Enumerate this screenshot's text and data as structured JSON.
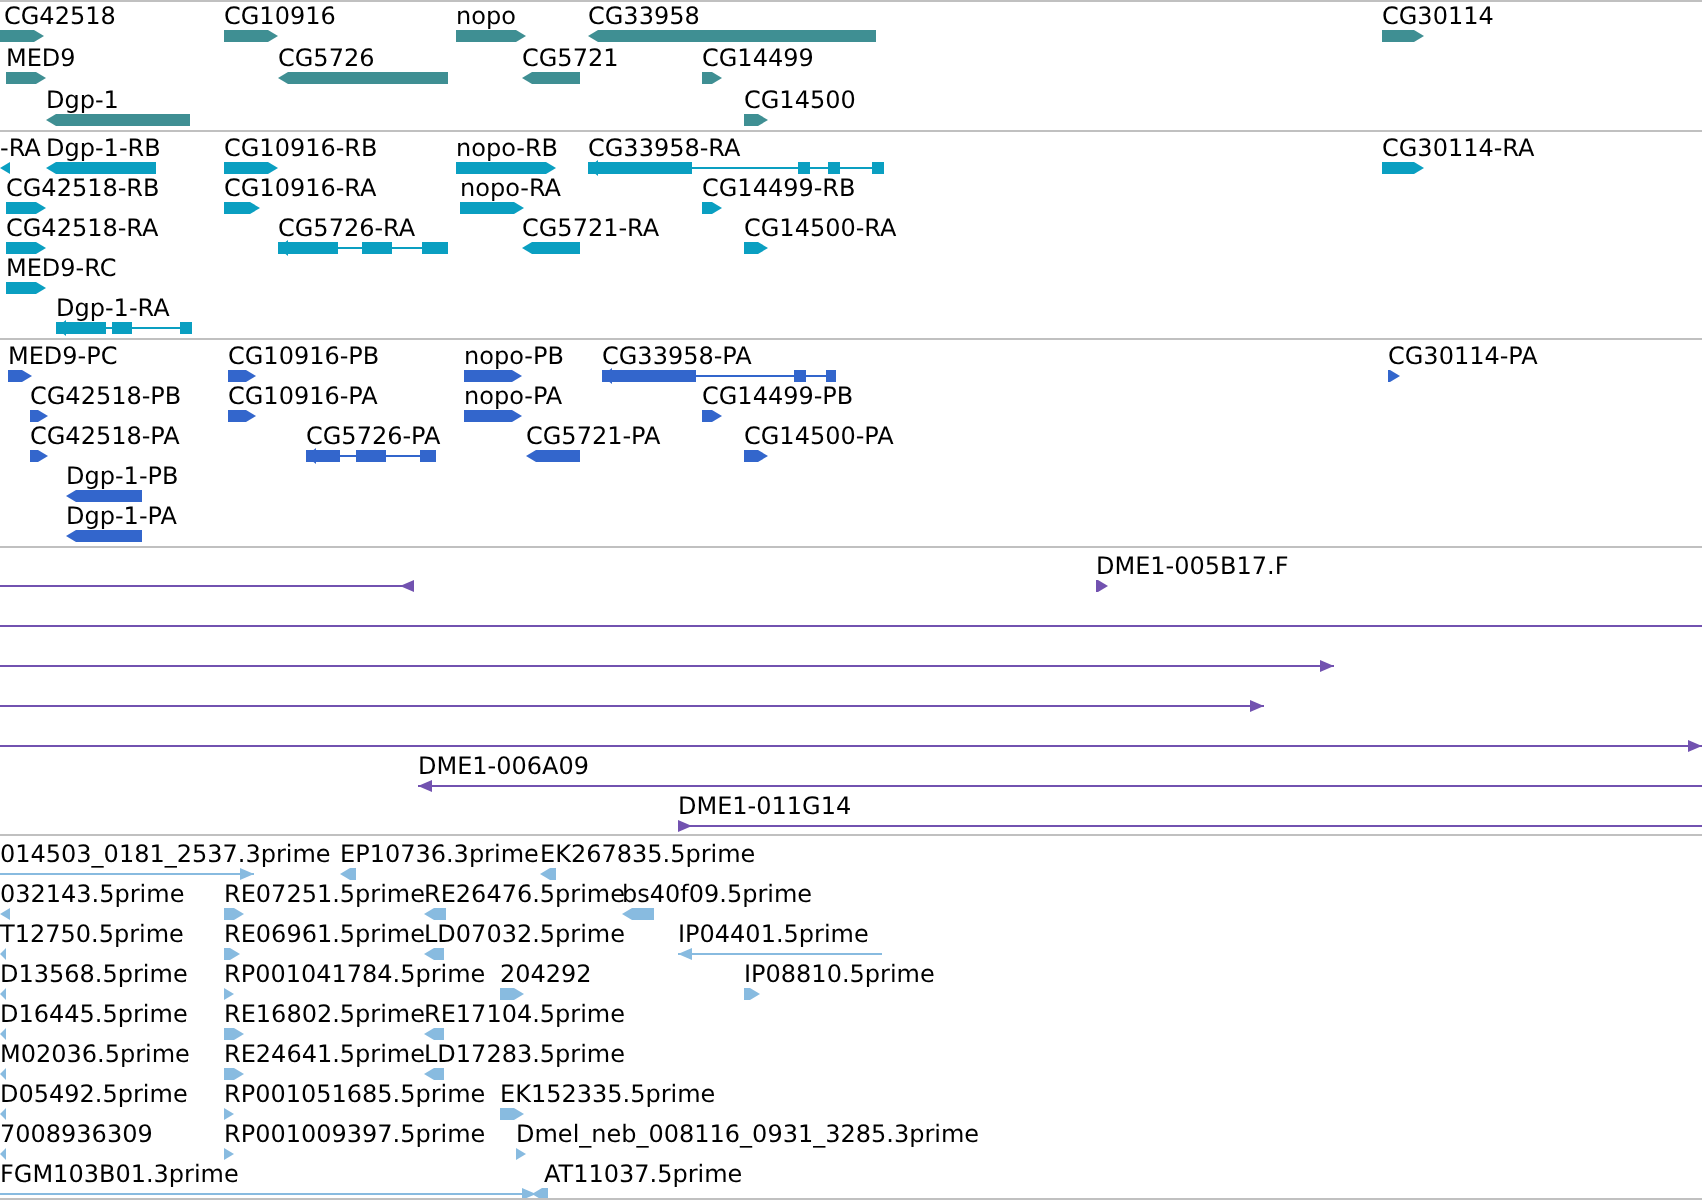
{
  "tracks": [
    {
      "kind": "gene",
      "features": [
        {
          "label": "CG42518",
          "kind": "bar",
          "reverse": false
        },
        {
          "label": "CG10916",
          "kind": "bar",
          "reverse": false
        },
        {
          "label": "nopo",
          "kind": "bar",
          "reverse": false
        },
        {
          "label": "CG33958",
          "kind": "bar",
          "reverse": true
        },
        {
          "label": "CG30114",
          "kind": "bar",
          "reverse": false
        },
        {
          "label": "MED9",
          "kind": "bar",
          "reverse": false
        },
        {
          "label": "CG5726",
          "kind": "bar",
          "reverse": true
        },
        {
          "label": "CG5721",
          "kind": "bar",
          "reverse": true
        },
        {
          "label": "CG14499",
          "kind": "bar",
          "reverse": false
        },
        {
          "label": "Dgp-1",
          "kind": "bar",
          "reverse": true
        },
        {
          "label": "CG14500",
          "kind": "bar",
          "reverse": false
        }
      ]
    },
    {
      "kind": "transcript",
      "features": [
        {
          "label": "-RA",
          "kind": "bar",
          "reverse": true
        },
        {
          "label": "Dgp-1-RB",
          "kind": "bar",
          "reverse": true
        },
        {
          "label": "CG10916-RB",
          "kind": "bar",
          "reverse": false
        },
        {
          "label": "nopo-RB",
          "kind": "bar",
          "reverse": false
        },
        {
          "label": "CG33958-RA",
          "kind": "exons",
          "reverse": true
        },
        {
          "label": "CG30114-RA",
          "kind": "bar",
          "reverse": false
        },
        {
          "label": "CG42518-RB",
          "kind": "bar",
          "reverse": false
        },
        {
          "label": "CG10916-RA",
          "kind": "bar",
          "reverse": false
        },
        {
          "label": "nopo-RA",
          "kind": "bar",
          "reverse": false
        },
        {
          "label": "CG14499-RB",
          "kind": "bar",
          "reverse": false
        },
        {
          "label": "CG42518-RA",
          "kind": "bar",
          "reverse": false
        },
        {
          "label": "CG5726-RA",
          "kind": "exons",
          "reverse": true
        },
        {
          "label": "CG5721-RA",
          "kind": "bar",
          "reverse": true
        },
        {
          "label": "CG14500-RA",
          "kind": "bar",
          "reverse": false
        },
        {
          "label": "MED9-RC",
          "kind": "bar",
          "reverse": false
        },
        {
          "label": "Dgp-1-RA",
          "kind": "exons",
          "reverse": true
        }
      ]
    },
    {
      "kind": "protein",
      "features": [
        {
          "label": "MED9-PC",
          "kind": "bar",
          "reverse": false
        },
        {
          "label": "CG10916-PB",
          "kind": "bar",
          "reverse": false
        },
        {
          "label": "nopo-PB",
          "kind": "bar",
          "reverse": false
        },
        {
          "label": "CG33958-PA",
          "kind": "exons",
          "reverse": true
        },
        {
          "label": "CG30114-PA",
          "kind": "bar",
          "reverse": false
        },
        {
          "label": "CG42518-PB",
          "kind": "bar",
          "reverse": false
        },
        {
          "label": "CG10916-PA",
          "kind": "bar",
          "reverse": false
        },
        {
          "label": "nopo-PA",
          "kind": "bar",
          "reverse": false
        },
        {
          "label": "CG14499-PB",
          "kind": "bar",
          "reverse": false
        },
        {
          "label": "CG42518-PA",
          "kind": "bar",
          "reverse": false
        },
        {
          "label": "CG5726-PA",
          "kind": "exons",
          "reverse": true
        },
        {
          "label": "CG5721-PA",
          "kind": "bar",
          "reverse": true
        },
        {
          "label": "CG14500-PA",
          "kind": "bar",
          "reverse": false
        },
        {
          "label": "Dgp-1-PB",
          "kind": "bar",
          "reverse": true
        },
        {
          "label": "Dgp-1-PA",
          "kind": "bar",
          "reverse": true
        }
      ]
    },
    {
      "kind": "clone",
      "features": [
        {
          "kind": "line",
          "reverse": true
        },
        {
          "label": "DME1-005B17.F",
          "kind": "bar",
          "reverse": false
        },
        {
          "kind": "line"
        },
        {
          "kind": "line",
          "reverse": false
        },
        {
          "kind": "line",
          "reverse": false
        },
        {
          "kind": "line",
          "reverse": false
        },
        {
          "label": "DME1-006A09",
          "kind": "line",
          "reverse": true
        },
        {
          "label": "DME1-011G14",
          "kind": "line",
          "reverse": false
        }
      ]
    },
    {
      "kind": "est",
      "features": [
        {
          "label": "014503_0181_2537.3prime",
          "kind": "line",
          "reverse": false
        },
        {
          "label": "EP10736.3prime",
          "kind": "bar",
          "reverse": true
        },
        {
          "label": "EK267835.5prime",
          "kind": "bar",
          "reverse": true
        },
        {
          "label": "032143.5prime",
          "kind": "bar",
          "reverse": true
        },
        {
          "label": "RE07251.5prime",
          "kind": "bar",
          "reverse": false
        },
        {
          "label": "RE26476.5prime",
          "kind": "bar",
          "reverse": true
        },
        {
          "label": "bs40f09.5prime",
          "kind": "bar",
          "reverse": true
        },
        {
          "label": "T12750.5prime",
          "kind": "bar",
          "reverse": true
        },
        {
          "label": "RE06961.5prime",
          "kind": "bar",
          "reverse": false
        },
        {
          "label": "LD07032.5prime",
          "kind": "bar",
          "reverse": true
        },
        {
          "label": "IP04401.5prime",
          "kind": "line",
          "reverse": true
        },
        {
          "label": "D13568.5prime",
          "kind": "bar",
          "reverse": true
        },
        {
          "label": "RP001041784.5prime",
          "kind": "bar",
          "reverse": false
        },
        {
          "label": "204292",
          "kind": "bar",
          "reverse": false
        },
        {
          "label": "IP08810.5prime",
          "kind": "bar",
          "reverse": false
        },
        {
          "label": "D16445.5prime",
          "kind": "bar",
          "reverse": true
        },
        {
          "label": "RE16802.5prime",
          "kind": "bar",
          "reverse": false
        },
        {
          "label": "RE17104.5prime",
          "kind": "bar",
          "reverse": true
        },
        {
          "label": "M02036.5prime",
          "kind": "bar",
          "reverse": true
        },
        {
          "label": "RE24641.5prime",
          "kind": "bar",
          "reverse": false
        },
        {
          "label": "LD17283.5prime",
          "kind": "bar",
          "reverse": true
        },
        {
          "label": "D05492.5prime",
          "kind": "bar",
          "reverse": true
        },
        {
          "label": "RP001051685.5prime",
          "kind": "bar",
          "reverse": false
        },
        {
          "label": "EK152335.5prime",
          "kind": "bar",
          "reverse": false
        },
        {
          "label": "7008936309",
          "kind": "bar",
          "reverse": true
        },
        {
          "label": "RP001009397.5prime",
          "kind": "bar",
          "reverse": false
        },
        {
          "label": "Dmel_neb_008116_0931_3285.3prime",
          "kind": "bar",
          "reverse": false
        },
        {
          "label": "FGM103B01.3prime",
          "kind": "line",
          "reverse": false
        },
        {
          "label": "AT11037.5prime",
          "kind": "bar",
          "reverse": true
        }
      ]
    }
  ]
}
